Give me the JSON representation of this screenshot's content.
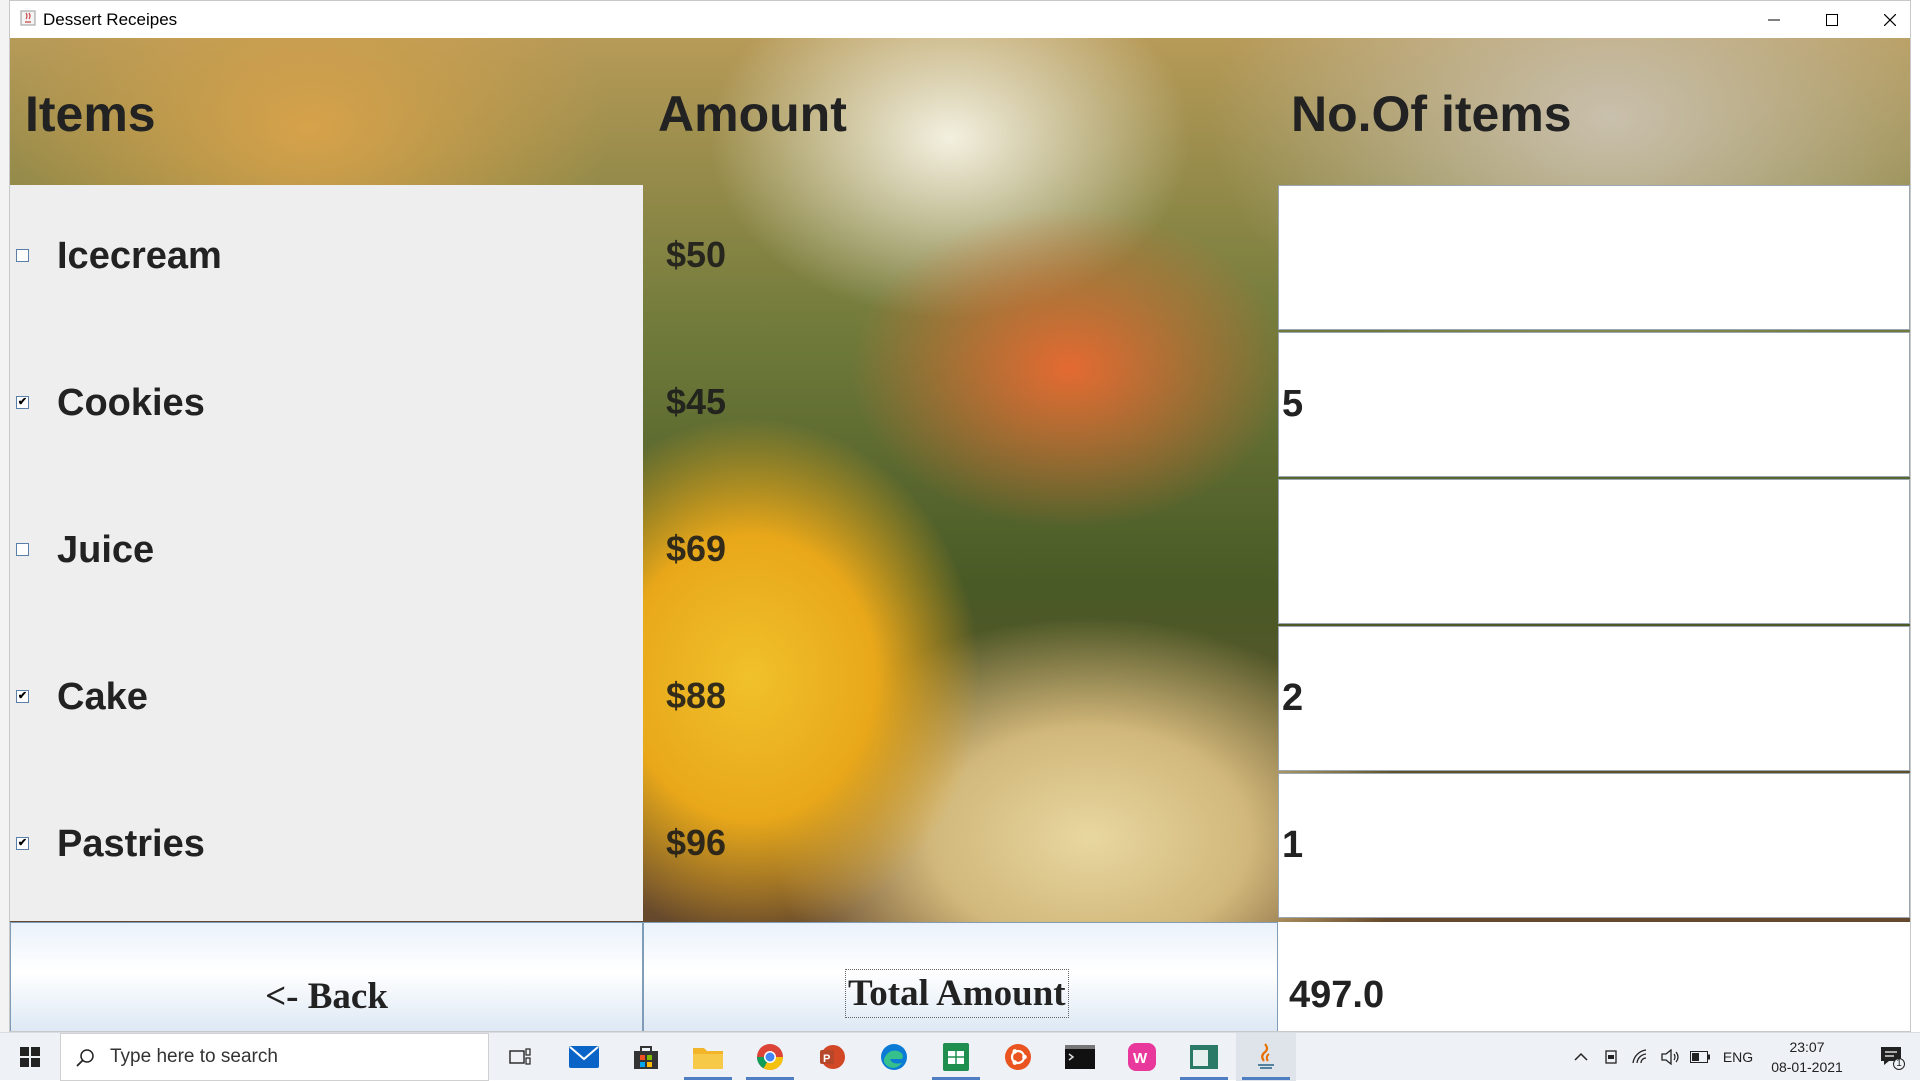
{
  "window": {
    "title": "Dessert Receipes"
  },
  "headers": {
    "items": "Items",
    "amount": "Amount",
    "count": "No.Of items"
  },
  "items": [
    {
      "label": "Icecream",
      "checked": false,
      "price": "$50",
      "qty": ""
    },
    {
      "label": "Cookies",
      "checked": true,
      "price": "$45",
      "qty": "5"
    },
    {
      "label": "Juice",
      "checked": false,
      "price": "$69",
      "qty": ""
    },
    {
      "label": "Cake",
      "checked": true,
      "price": "$88",
      "qty": "2"
    },
    {
      "label": "Pastries",
      "checked": true,
      "price": "$96",
      "qty": "1"
    }
  ],
  "footer": {
    "back_label": "<- Back",
    "total_label": "Total Amount",
    "total_value": "497.0"
  },
  "taskbar": {
    "search_placeholder": "Type here to search",
    "apps": [
      "task-view",
      "mail",
      "store",
      "file-explorer",
      "chrome",
      "powerpoint",
      "edge",
      "sheets",
      "ubuntu",
      "terminal",
      "wamp",
      "app-window",
      "java"
    ],
    "tray_language": "ENG",
    "time": "23:07",
    "date": "08-01-2021",
    "notification_count": "1"
  }
}
